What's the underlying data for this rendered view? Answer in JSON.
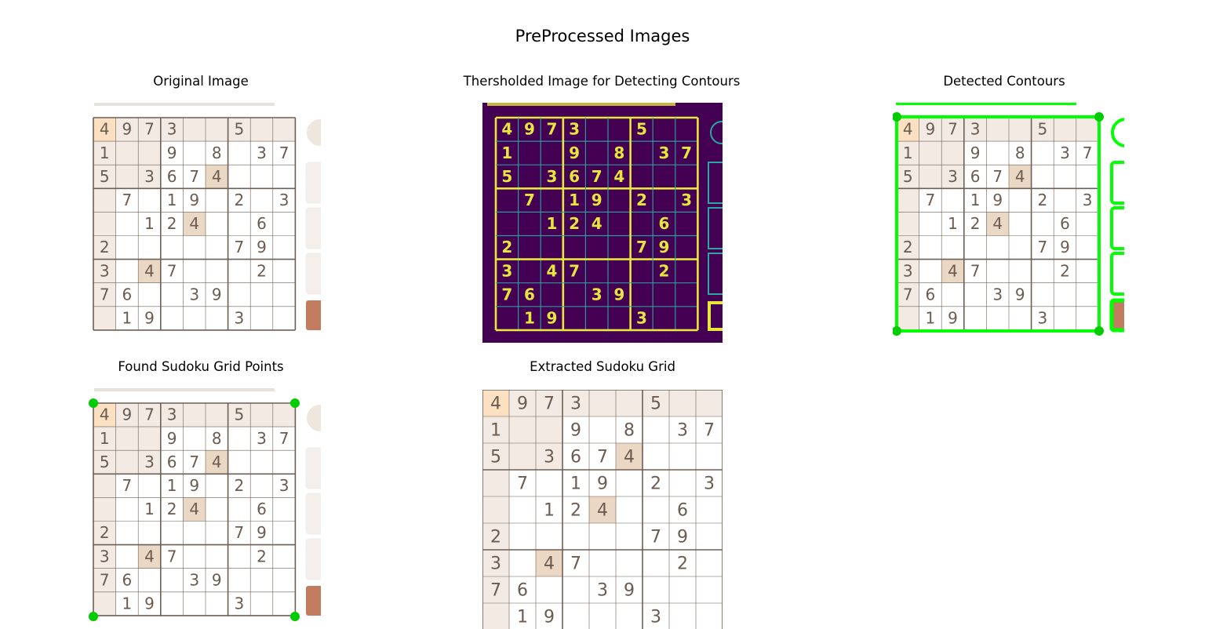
{
  "figure_title": "PreProcessed Images",
  "panels": {
    "p1": "Original Image",
    "p2": "Thersholded Image for Detecting Contours",
    "p3": "Detected Contours",
    "p4": "Found Sudoku Grid Points",
    "p5": "Extracted Sudoku Grid"
  },
  "grid": [
    [
      "4",
      "9",
      "7",
      "3",
      "",
      "",
      "5",
      "",
      ""
    ],
    [
      "1",
      "",
      "",
      "9",
      "",
      "8",
      "",
      "3",
      "7"
    ],
    [
      "5",
      "",
      "3",
      "6",
      "7",
      "4",
      "",
      "",
      ""
    ],
    [
      "",
      "7",
      "",
      "1",
      "9",
      "",
      "2",
      "",
      "3"
    ],
    [
      "",
      "",
      "1",
      "2",
      "4",
      "",
      "",
      "6",
      ""
    ],
    [
      "2",
      "",
      "",
      "",
      "",
      "",
      "7",
      "9",
      ""
    ],
    [
      "3",
      "",
      "4",
      "7",
      "",
      "",
      "",
      "2",
      ""
    ],
    [
      "7",
      "6",
      "",
      "",
      "3",
      "9",
      "",
      "",
      ""
    ],
    [
      "",
      "1",
      "9",
      "",
      "",
      "",
      "3",
      "",
      ""
    ]
  ],
  "colors": {
    "cell_shaded": "#f3ebe3",
    "cell_selected": "#fbe0c2",
    "cell_highlight": "#ead8c4",
    "grid_line": "#6e5f54",
    "digit": "#6b5b50",
    "thresh_bg": "#440154",
    "thresh_line": "#e6e63c",
    "contour": "#00ff00",
    "corner_point": "#00cc00",
    "button_brown": "#c17c5f"
  }
}
